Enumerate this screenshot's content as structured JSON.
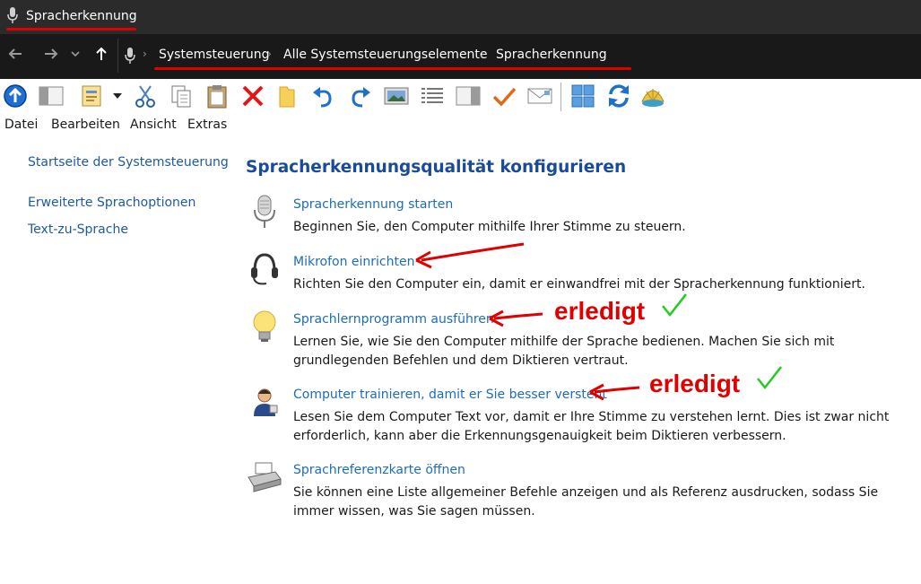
{
  "window": {
    "title": "Spracherkennung"
  },
  "address": {
    "crumbs": [
      "Systemsteuerung",
      "Alle Systemsteuerungselemente",
      "Spracherkennung"
    ]
  },
  "menu": [
    "Datei",
    "Bearbeiten",
    "Ansicht",
    "Extras"
  ],
  "toolbar": {
    "icons": [
      "up-level-icon",
      "pane-icon",
      "properties-icon",
      "dropdown-arrow-icon",
      "cut-icon",
      "copy-icon",
      "paste-icon",
      "delete-icon",
      "folder-icon",
      "undo-icon",
      "redo-icon",
      "image-view-icon",
      "details-view-icon",
      "preview-pane-icon",
      "checkmark-icon",
      "mail-icon",
      "tiles-icon",
      "refresh-icon",
      "shell-icon"
    ]
  },
  "sidebar": {
    "home": "Startseite der Systemsteuerung",
    "links": [
      "Erweiterte Sprachoptionen",
      "Text-zu-Sprache"
    ]
  },
  "main": {
    "title": "Spracherkennungsqualität konfigurieren",
    "tasks": [
      {
        "icon": "microphone-icon",
        "link": "Spracherkennung starten",
        "desc": "Beginnen Sie, den Computer mithilfe Ihrer Stimme zu steuern."
      },
      {
        "icon": "headset-icon",
        "link": "Mikrofon einrichten",
        "desc": "Richten Sie den Computer ein, damit er einwandfrei mit der Spracherkennung funktioniert."
      },
      {
        "icon": "lightbulb-icon",
        "link": "Sprachlernprogramm ausführen",
        "desc": "Lernen Sie, wie Sie den Computer mithilfe der Sprache bedienen. Machen Sie sich mit grundlegenden Befehlen und dem Diktieren vertraut."
      },
      {
        "icon": "user-speaking-icon",
        "link": "Computer trainieren, damit er Sie besser versteht",
        "desc": "Lesen Sie dem Computer Text vor, damit er Ihre Stimme zu verstehen lernt. Dies ist zwar nicht erforderlich, kann aber die Erkennungsgenauigkeit beim Diktieren verbessern."
      },
      {
        "icon": "printer-icon",
        "link": "Sprachreferenzkarte öffnen",
        "desc": "Sie können eine Liste allgemeiner Befehle anzeigen und als Referenz ausdrucken, sodass Sie immer wissen, was Sie sagen müssen."
      }
    ]
  },
  "annotations": {
    "done_1": "erledigt",
    "done_2": "erledigt",
    "color": "#e00000",
    "check_color": "#22cc22"
  }
}
